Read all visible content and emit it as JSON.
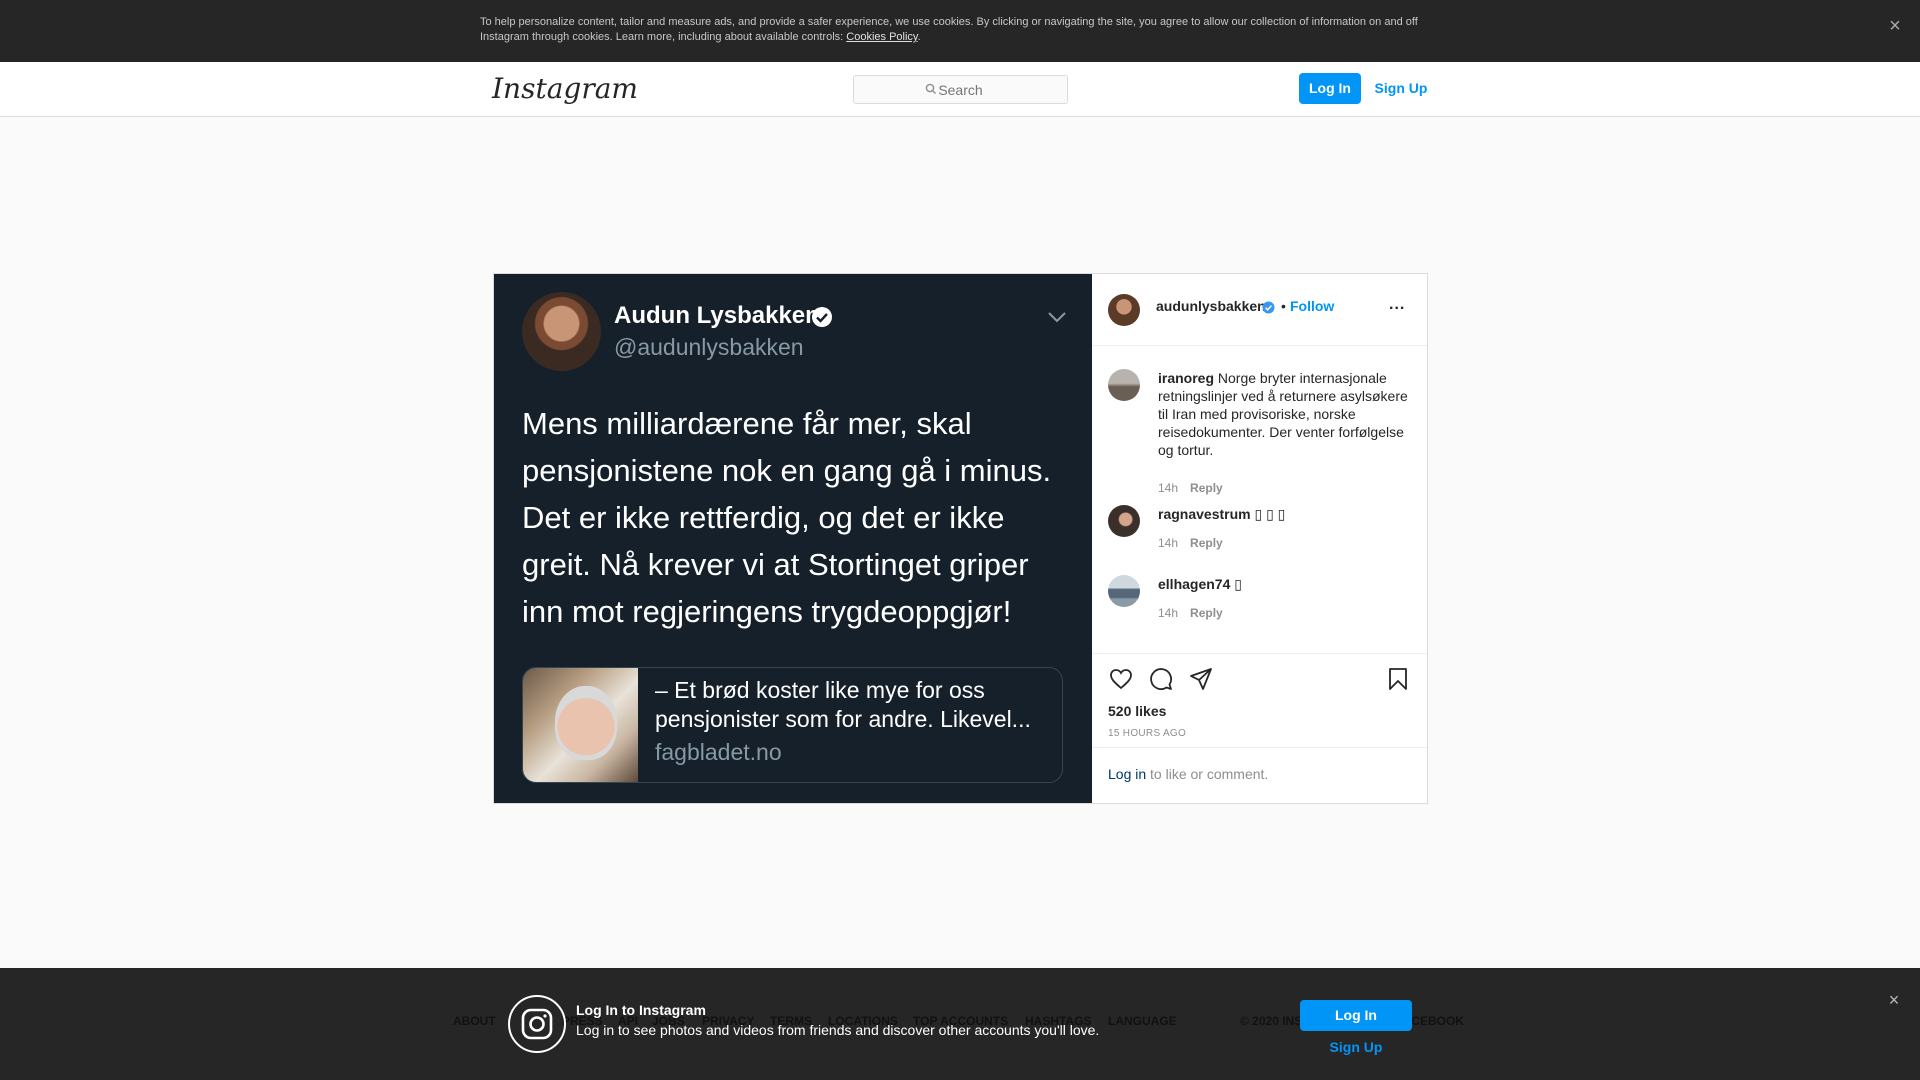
{
  "cookie_banner": {
    "text": "To help personalize content, tailor and measure ads, and provide a safer experience, we use cookies. By clicking or navigating the site, you agree to allow our collection of information on and off Instagram through cookies. Learn more, including about available controls: ",
    "link_label": "Cookies Policy",
    "close_icon": "close-icon"
  },
  "nav": {
    "logo": "Instagram",
    "search_placeholder": "Search",
    "login_label": "Log In",
    "signup_label": "Sign Up"
  },
  "post": {
    "tweet": {
      "name": "Audun Lysbakken",
      "handle": "@audunlysbakken",
      "text": "Mens milliardærene får mer, skal pensjonistene nok en gang gå i minus. Det er ikke rettferdig, og det er ikke greit. Nå krever vi at Stortinget griper inn mot regjeringens trygdeoppgjør!",
      "link_title": "– Et brød koster like mye for oss pensjonister som for andre. Likevel...",
      "link_domain": "fagbladet.no"
    },
    "author": "audunlysbakken",
    "dot": "•",
    "follow_label": "Follow",
    "more": "...",
    "comments": [
      {
        "user": "iranoreg",
        "text": "Norge bryter internasjonale retningslinjer ved å returnere asylsøkere til Iran med provisoriske, norske reisedokumenter. Der venter forfølgelse og tortur.",
        "time": "14h",
        "reply": "Reply"
      },
      {
        "user": "ragnavestrum",
        "text": "▯ ▯ ▯",
        "time": "14h",
        "reply": "Reply"
      },
      {
        "user": "ellhagen74",
        "text": "▯",
        "time": "14h",
        "reply": "Reply"
      }
    ],
    "likes": "520 likes",
    "time_ago": "15 HOURS AGO",
    "login_link": "Log in",
    "login_suffix": " to like or comment."
  },
  "footer": {
    "links": [
      "ABOUT",
      "HELP",
      "PRESS",
      "API",
      "JOBS",
      "PRIVACY",
      "TERMS",
      "LOCATIONS",
      "TOP ACCOUNTS",
      "HASHTAGS",
      "LANGUAGE"
    ],
    "copyright": "© 2020 INSTAGRAM FROM FACEBOOK"
  },
  "login_overlay": {
    "title": "Log In to Instagram",
    "subtitle": "Log in to see photos and videos from friends and discover other accounts you'll love.",
    "login_label": "Log In",
    "signup_label": "Sign Up",
    "close_icon": "close-icon"
  }
}
